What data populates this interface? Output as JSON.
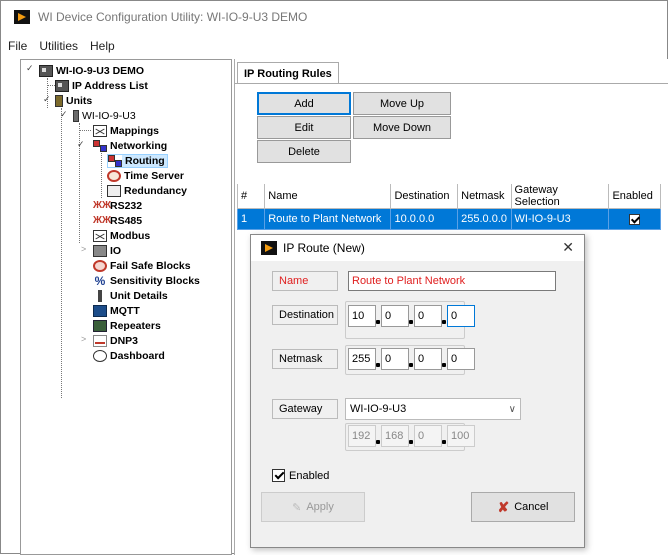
{
  "window": {
    "title": "WI Device Configuration Utility: WI-IO-9-U3 DEMO"
  },
  "menu": [
    "File",
    "Utilities",
    "Help"
  ],
  "tree": {
    "root": "WI-IO-9-U3 DEMO",
    "ip_address_list": "IP Address List",
    "units": "Units",
    "unit": "WI-IO-9-U3",
    "mappings": "Mappings",
    "networking": "Networking",
    "routing": "Routing",
    "time_server": "Time Server",
    "redundancy": "Redundancy",
    "rs232": "RS232",
    "rs485": "RS485",
    "modbus": "Modbus",
    "io": "IO",
    "fail_safe_blocks": "Fail Safe Blocks",
    "sensitivity_blocks": "Sensitivity Blocks",
    "unit_details": "Unit Details",
    "mqtt": "MQTT",
    "repeaters": "Repeaters",
    "dnp3": "DNP3",
    "dashboard": "Dashboard"
  },
  "tab": {
    "label": "IP Routing Rules"
  },
  "toolbar": {
    "add": "Add",
    "edit": "Edit",
    "delete": "Delete",
    "move_up": "Move Up",
    "move_down": "Move Down"
  },
  "table": {
    "columns": [
      "#",
      "Name",
      "Destination",
      "Netmask",
      "Gateway Selection",
      "Enabled"
    ],
    "rows": [
      {
        "num": "1",
        "name": "Route to Plant Network",
        "destination": "10.0.0.0",
        "netmask": "255.0.0.0",
        "gateway": "WI-IO-9-U3",
        "enabled": true
      }
    ]
  },
  "dialog": {
    "title": "IP Route (New)",
    "name_label": "Name",
    "name_value": "Route to Plant Network",
    "destination_label": "Destination",
    "destination": [
      "10",
      "0",
      "0",
      "0"
    ],
    "netmask_label": "Netmask",
    "netmask": [
      "255",
      "0",
      "0",
      "0"
    ],
    "gateway_label": "Gateway",
    "gateway_value": "WI-IO-9-U3",
    "gateway_ip": [
      "192",
      "168",
      "0",
      "100"
    ],
    "enabled_label": "Enabled",
    "enabled": true,
    "apply_label": "Apply",
    "cancel_label": "Cancel"
  },
  "colors": {
    "accent": "#0078d7",
    "required": "#e02020",
    "cancel_icon": "#c0392b"
  }
}
